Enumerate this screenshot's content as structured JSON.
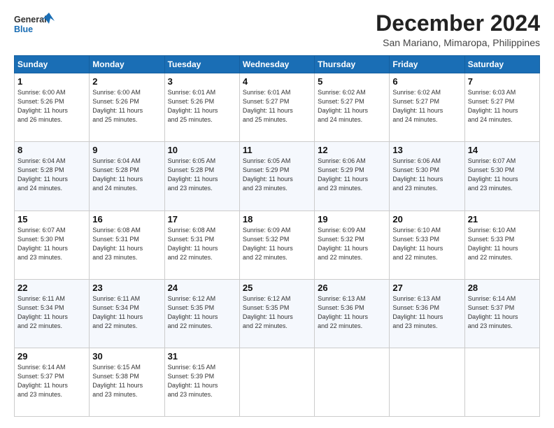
{
  "logo": {
    "general": "General",
    "blue": "Blue"
  },
  "title": "December 2024",
  "subtitle": "San Mariano, Mimaropa, Philippines",
  "weekdays": [
    "Sunday",
    "Monday",
    "Tuesday",
    "Wednesday",
    "Thursday",
    "Friday",
    "Saturday"
  ],
  "weeks": [
    [
      {
        "day": "1",
        "info": "Sunrise: 6:00 AM\nSunset: 5:26 PM\nDaylight: 11 hours\nand 26 minutes."
      },
      {
        "day": "2",
        "info": "Sunrise: 6:00 AM\nSunset: 5:26 PM\nDaylight: 11 hours\nand 25 minutes."
      },
      {
        "day": "3",
        "info": "Sunrise: 6:01 AM\nSunset: 5:26 PM\nDaylight: 11 hours\nand 25 minutes."
      },
      {
        "day": "4",
        "info": "Sunrise: 6:01 AM\nSunset: 5:27 PM\nDaylight: 11 hours\nand 25 minutes."
      },
      {
        "day": "5",
        "info": "Sunrise: 6:02 AM\nSunset: 5:27 PM\nDaylight: 11 hours\nand 24 minutes."
      },
      {
        "day": "6",
        "info": "Sunrise: 6:02 AM\nSunset: 5:27 PM\nDaylight: 11 hours\nand 24 minutes."
      },
      {
        "day": "7",
        "info": "Sunrise: 6:03 AM\nSunset: 5:27 PM\nDaylight: 11 hours\nand 24 minutes."
      }
    ],
    [
      {
        "day": "8",
        "info": "Sunrise: 6:04 AM\nSunset: 5:28 PM\nDaylight: 11 hours\nand 24 minutes."
      },
      {
        "day": "9",
        "info": "Sunrise: 6:04 AM\nSunset: 5:28 PM\nDaylight: 11 hours\nand 24 minutes."
      },
      {
        "day": "10",
        "info": "Sunrise: 6:05 AM\nSunset: 5:28 PM\nDaylight: 11 hours\nand 23 minutes."
      },
      {
        "day": "11",
        "info": "Sunrise: 6:05 AM\nSunset: 5:29 PM\nDaylight: 11 hours\nand 23 minutes."
      },
      {
        "day": "12",
        "info": "Sunrise: 6:06 AM\nSunset: 5:29 PM\nDaylight: 11 hours\nand 23 minutes."
      },
      {
        "day": "13",
        "info": "Sunrise: 6:06 AM\nSunset: 5:30 PM\nDaylight: 11 hours\nand 23 minutes."
      },
      {
        "day": "14",
        "info": "Sunrise: 6:07 AM\nSunset: 5:30 PM\nDaylight: 11 hours\nand 23 minutes."
      }
    ],
    [
      {
        "day": "15",
        "info": "Sunrise: 6:07 AM\nSunset: 5:30 PM\nDaylight: 11 hours\nand 23 minutes."
      },
      {
        "day": "16",
        "info": "Sunrise: 6:08 AM\nSunset: 5:31 PM\nDaylight: 11 hours\nand 23 minutes."
      },
      {
        "day": "17",
        "info": "Sunrise: 6:08 AM\nSunset: 5:31 PM\nDaylight: 11 hours\nand 22 minutes."
      },
      {
        "day": "18",
        "info": "Sunrise: 6:09 AM\nSunset: 5:32 PM\nDaylight: 11 hours\nand 22 minutes."
      },
      {
        "day": "19",
        "info": "Sunrise: 6:09 AM\nSunset: 5:32 PM\nDaylight: 11 hours\nand 22 minutes."
      },
      {
        "day": "20",
        "info": "Sunrise: 6:10 AM\nSunset: 5:33 PM\nDaylight: 11 hours\nand 22 minutes."
      },
      {
        "day": "21",
        "info": "Sunrise: 6:10 AM\nSunset: 5:33 PM\nDaylight: 11 hours\nand 22 minutes."
      }
    ],
    [
      {
        "day": "22",
        "info": "Sunrise: 6:11 AM\nSunset: 5:34 PM\nDaylight: 11 hours\nand 22 minutes."
      },
      {
        "day": "23",
        "info": "Sunrise: 6:11 AM\nSunset: 5:34 PM\nDaylight: 11 hours\nand 22 minutes."
      },
      {
        "day": "24",
        "info": "Sunrise: 6:12 AM\nSunset: 5:35 PM\nDaylight: 11 hours\nand 22 minutes."
      },
      {
        "day": "25",
        "info": "Sunrise: 6:12 AM\nSunset: 5:35 PM\nDaylight: 11 hours\nand 22 minutes."
      },
      {
        "day": "26",
        "info": "Sunrise: 6:13 AM\nSunset: 5:36 PM\nDaylight: 11 hours\nand 22 minutes."
      },
      {
        "day": "27",
        "info": "Sunrise: 6:13 AM\nSunset: 5:36 PM\nDaylight: 11 hours\nand 23 minutes."
      },
      {
        "day": "28",
        "info": "Sunrise: 6:14 AM\nSunset: 5:37 PM\nDaylight: 11 hours\nand 23 minutes."
      }
    ],
    [
      {
        "day": "29",
        "info": "Sunrise: 6:14 AM\nSunset: 5:37 PM\nDaylight: 11 hours\nand 23 minutes."
      },
      {
        "day": "30",
        "info": "Sunrise: 6:15 AM\nSunset: 5:38 PM\nDaylight: 11 hours\nand 23 minutes."
      },
      {
        "day": "31",
        "info": "Sunrise: 6:15 AM\nSunset: 5:39 PM\nDaylight: 11 hours\nand 23 minutes."
      },
      null,
      null,
      null,
      null
    ]
  ]
}
